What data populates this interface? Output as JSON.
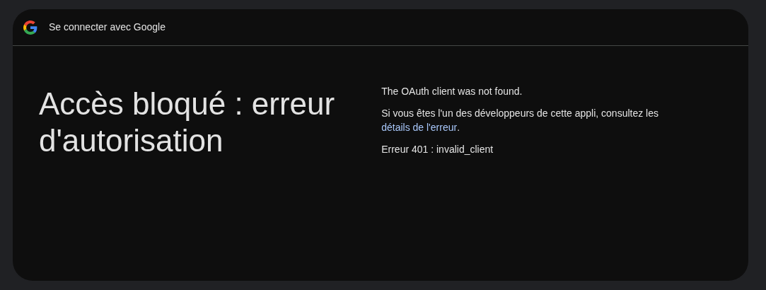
{
  "header": {
    "title": "Se connecter avec Google"
  },
  "heading": "Accès bloqué : erreur d'autorisation",
  "messages": [
    {
      "kind": "text",
      "text": "The OAuth client was not found."
    },
    {
      "kind": "link",
      "text": "Si vous êtes l'un des développeurs de cette appli, consultez les",
      "link": "détails de l'erreur",
      "suffix": "."
    },
    {
      "kind": "text",
      "text": "Erreur 401 : invalid_client"
    }
  ]
}
